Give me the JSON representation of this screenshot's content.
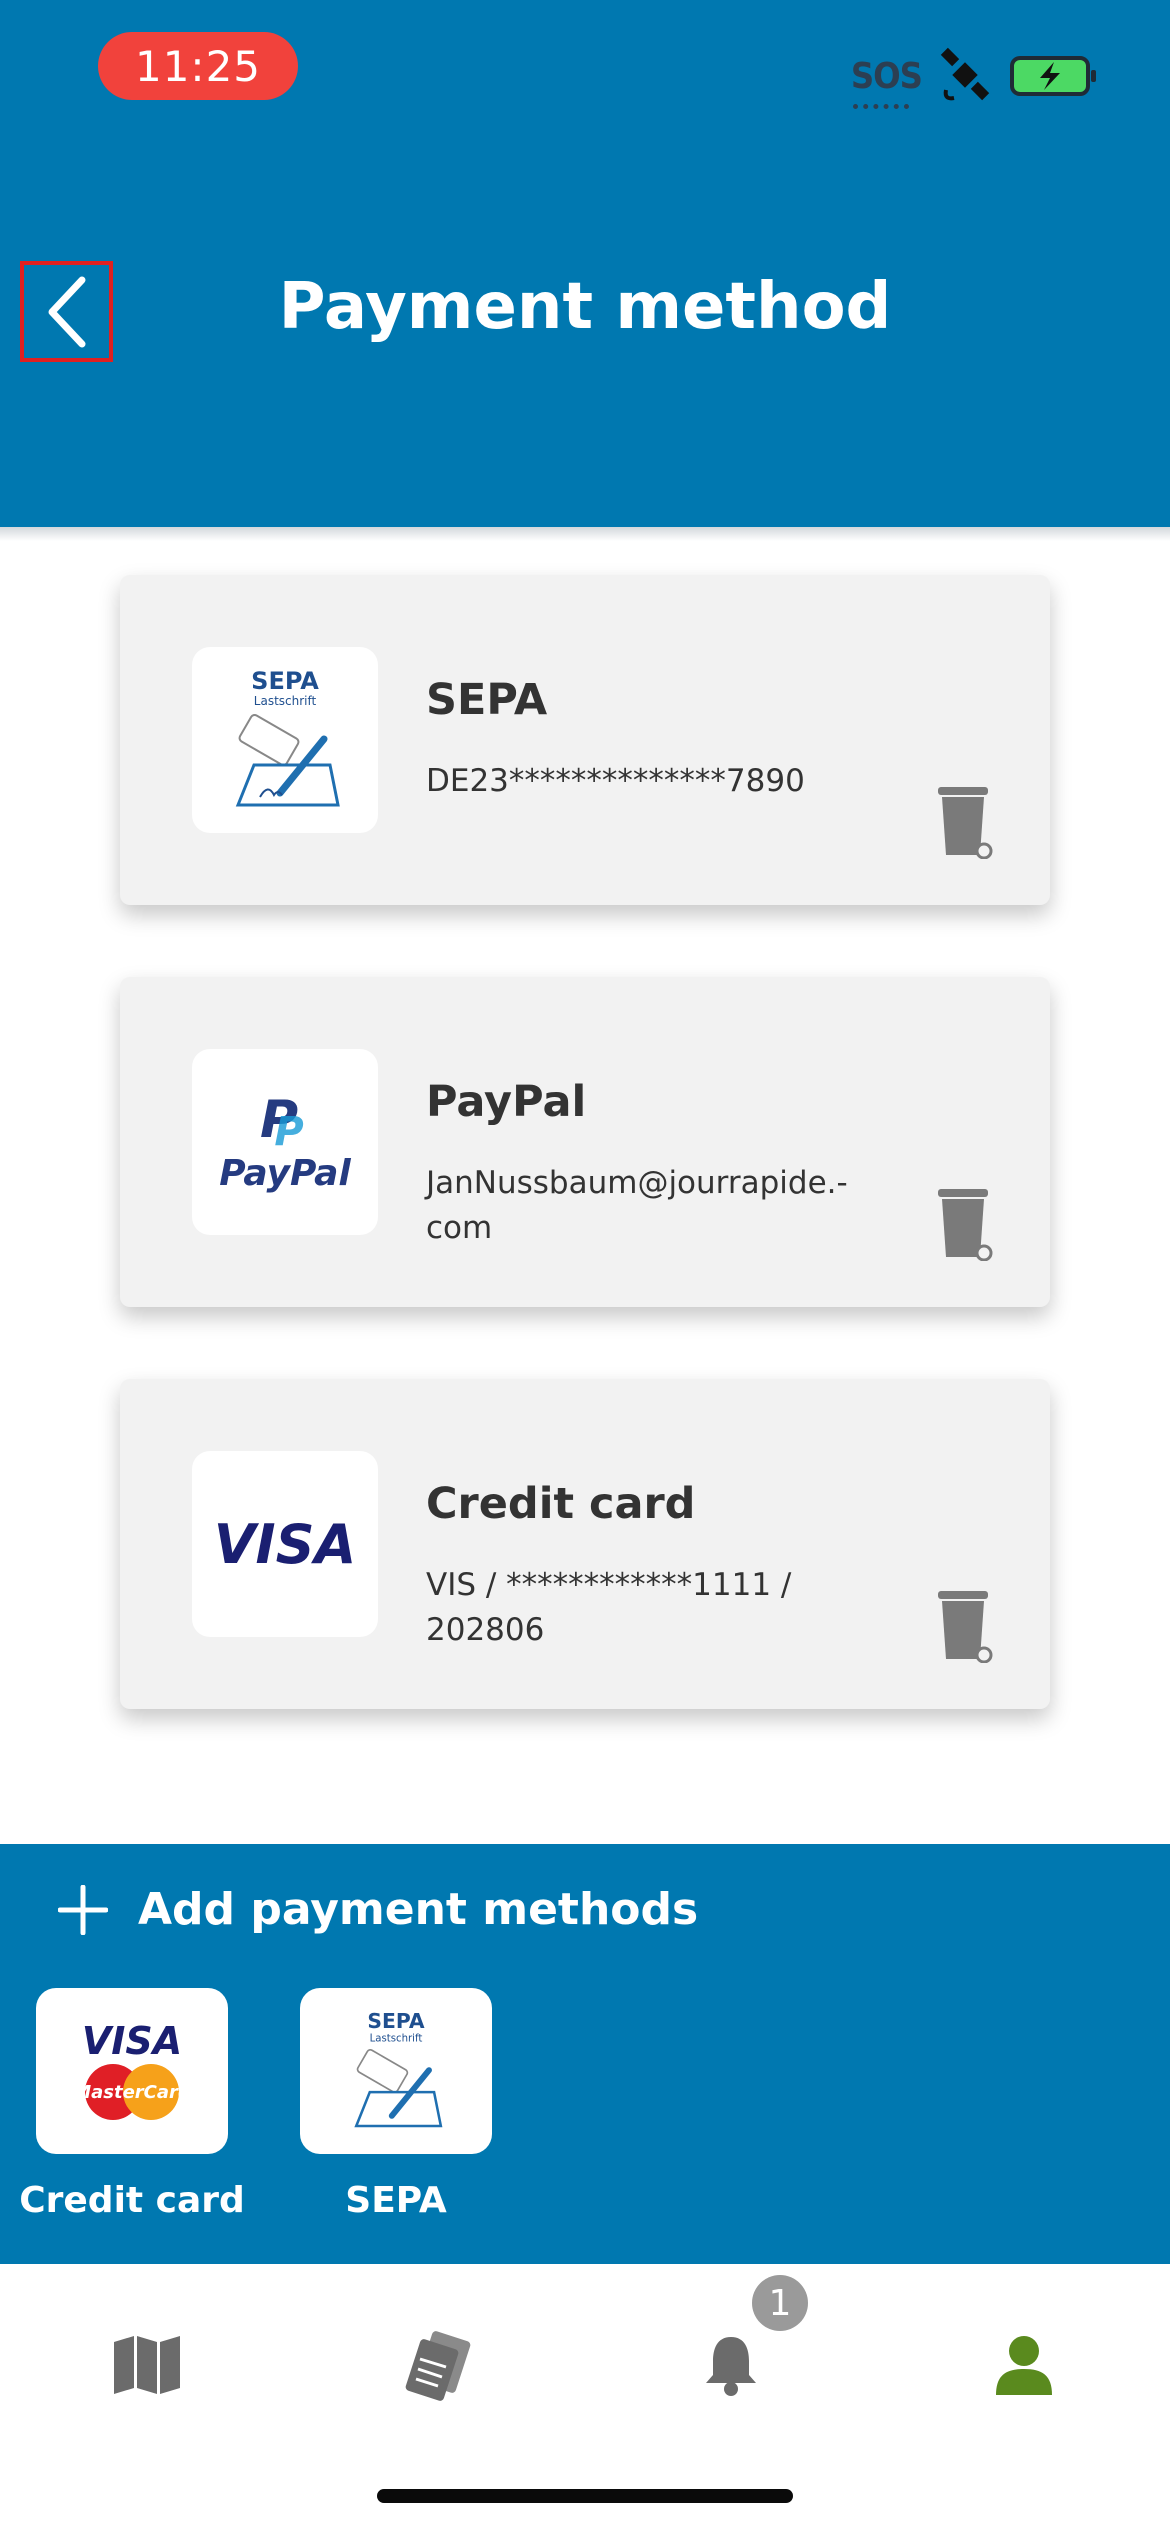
{
  "status_bar": {
    "time": "11:25",
    "sos_label": "SOS"
  },
  "header": {
    "title": "Payment method",
    "back_icon": "chevron-left-icon"
  },
  "payment_methods": [
    {
      "title": "SEPA",
      "detail": "DE23**************7890",
      "logo_text": "SEPA",
      "logo_sub": "Lastschrift",
      "delete_icon": "trash-icon"
    },
    {
      "title": "PayPal",
      "detail": "JanNussbaum@jourrapide.-\ncom",
      "logo_text": "PayPal",
      "delete_icon": "trash-icon"
    },
    {
      "title": "Credit card",
      "detail": "VIS / ************1111 /\n202806",
      "logo_text": "VISA",
      "delete_icon": "trash-icon"
    }
  ],
  "add_section": {
    "label": "Add payment methods",
    "options": [
      {
        "label": "Credit card",
        "logo_visa": "VISA",
        "logo_mc": "MasterCard"
      },
      {
        "label": "SEPA",
        "logo_text": "SEPA",
        "logo_sub": "Lastschrift"
      }
    ]
  },
  "tabbar": {
    "tabs": [
      {
        "icon": "map-icon",
        "active": false
      },
      {
        "icon": "tickets-icon",
        "active": false
      },
      {
        "icon": "bell-icon",
        "active": false,
        "badge": "1"
      },
      {
        "icon": "profile-icon",
        "active": true
      }
    ]
  },
  "colors": {
    "brand_blue": "#0078b0",
    "card_bg": "#f2f2f2",
    "active_tab": "#5a8a1e",
    "inactive_tab": "#6b6b6b",
    "time_pill": "#f1423c"
  }
}
